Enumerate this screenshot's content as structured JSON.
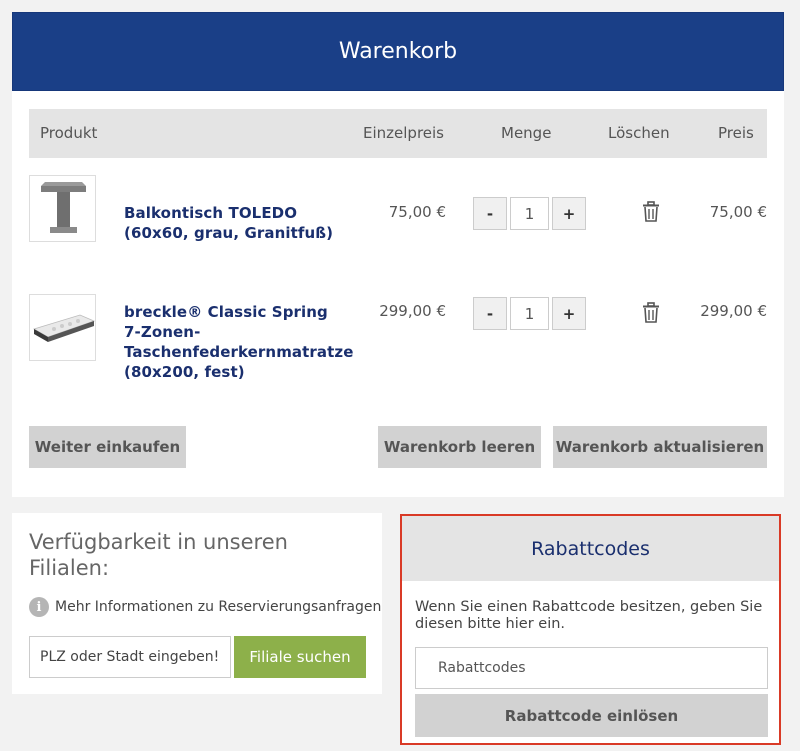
{
  "cart": {
    "title": "Warenkorb",
    "columns": {
      "product": "Produkt",
      "unit_price": "Einzelpreis",
      "quantity": "Menge",
      "delete": "Löschen",
      "price": "Preis"
    },
    "items": [
      {
        "name": "Balkontisch TOLEDO (60x60, grau, Granitfuß)",
        "unit_price": "75,00 €",
        "minus": "-",
        "quantity": "1",
        "plus": "+",
        "total": "75,00 €",
        "image_icon": "table-product-image"
      },
      {
        "name": "breckle® Classic Spring 7-Zonen-Taschenfederkernmatratze (80x200, fest)",
        "unit_price": "299,00 €",
        "minus": "-",
        "quantity": "1",
        "plus": "+",
        "total": "299,00 €",
        "image_icon": "mattress-product-image"
      }
    ],
    "buttons": {
      "continue": "Weiter einkaufen",
      "clear": "Warenkorb leeren",
      "update": "Warenkorb aktualisieren"
    }
  },
  "stores": {
    "title": "Verfügbarkeit in unseren Filialen:",
    "info_text": "Mehr Informationen zu Reservierungsanfragen",
    "info_icon": "i",
    "input_placeholder": "PLZ oder Stadt eingeben!",
    "search_button": "Filiale suchen"
  },
  "coupons": {
    "title": "Rabattcodes",
    "description": "Wenn Sie einen Rabattcode besitzen, geben Sie diesen bitte hier ein.",
    "input_placeholder": "Rabattcodes",
    "redeem_button": "Rabattcode einlösen"
  },
  "colors": {
    "header_blue": "#1a3f87",
    "link_navy": "#1a2f6e",
    "green_button": "#8db04a",
    "highlight_red": "#d93a26"
  }
}
